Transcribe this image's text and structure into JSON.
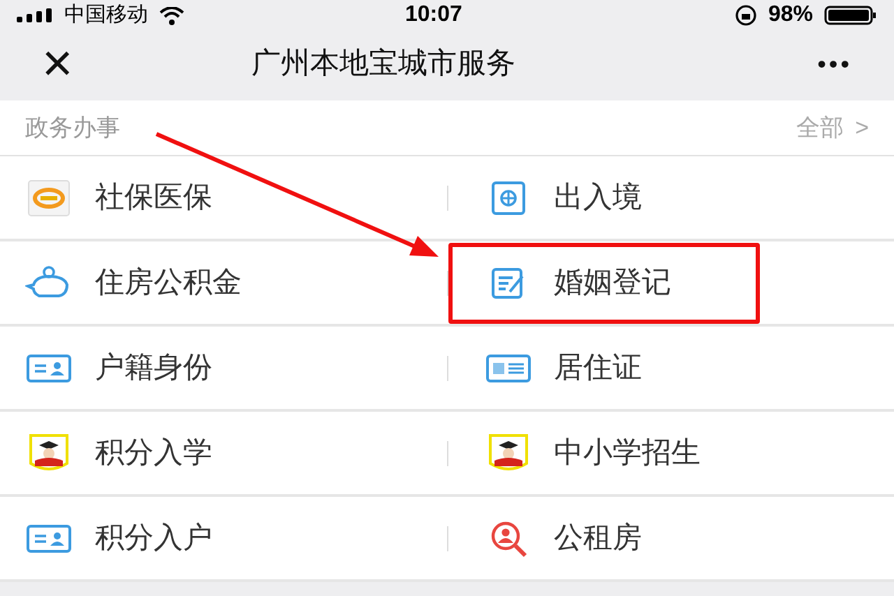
{
  "status_bar": {
    "carrier": "中国移动",
    "time": "10:07",
    "battery": "98%"
  },
  "nav_bar": {
    "close": "×",
    "title": "广州本地宝城市服务",
    "more": "•••"
  },
  "section": {
    "title": "政务办事",
    "link": "全部",
    "chevron": ">"
  },
  "items": [
    {
      "label": "社保医保",
      "kind": "si",
      "highlighted": false
    },
    {
      "label": "出入境",
      "kind": "passport",
      "highlighted": false
    },
    {
      "label": "住房公积金",
      "kind": "piggy",
      "highlighted": false
    },
    {
      "label": "婚姻登记",
      "kind": "form",
      "highlighted": true
    },
    {
      "label": "户籍身份",
      "kind": "idcard",
      "highlighted": false
    },
    {
      "label": "居住证",
      "kind": "rescard",
      "highlighted": false
    },
    {
      "label": "积分入学",
      "kind": "student",
      "highlighted": false
    },
    {
      "label": "中小学招生",
      "kind": "student",
      "highlighted": false
    },
    {
      "label": "积分入户",
      "kind": "idcard",
      "highlighted": false
    },
    {
      "label": "公租房",
      "kind": "search",
      "highlighted": false
    }
  ]
}
